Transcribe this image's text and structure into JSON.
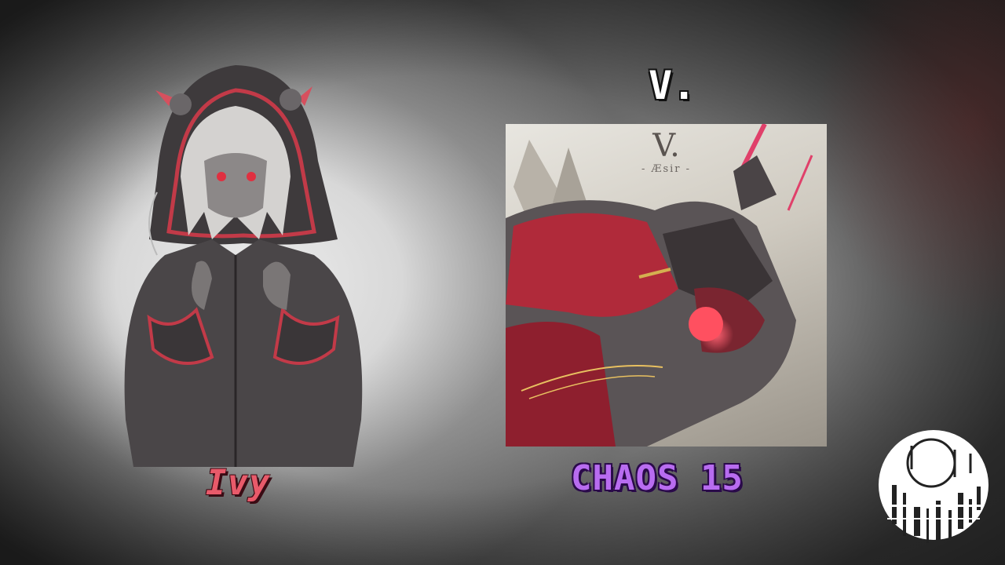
{
  "character": {
    "name": "Ivy",
    "name_color": "#e85a6a",
    "image_icon": "hooded-character-portrait"
  },
  "song": {
    "title": "V.",
    "jacket": {
      "logo_text": "V.",
      "subtitle": "- Æsir -",
      "image_icon": "red-mecha-jacket-art"
    },
    "difficulty": "CHAOS 15",
    "difficulty_color": "#b86cf0"
  },
  "brand_logo_icon": "glitch-circle-logo"
}
